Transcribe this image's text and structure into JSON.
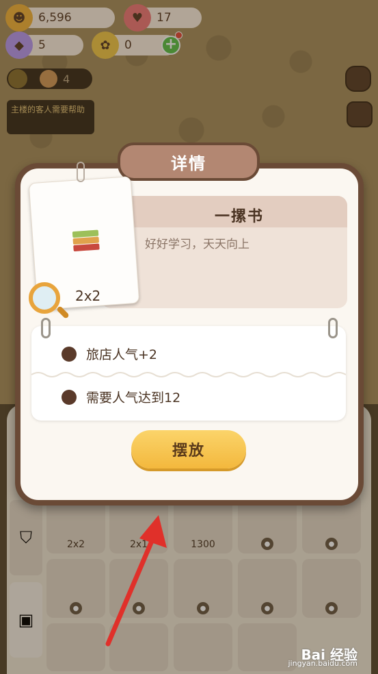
{
  "resources": {
    "coins": "6,596",
    "hearts": "17",
    "gems": "5",
    "tickets": "0"
  },
  "level": {
    "value": "4"
  },
  "quest": {
    "text": "主楼的客人需要帮助"
  },
  "modal": {
    "title": "详情",
    "item_name": "一摞书",
    "item_desc": "好好学习，天天向上",
    "size": "2x2",
    "stats": [
      {
        "label": "旅店人气+2"
      },
      {
        "label": "需要人气达到12"
      }
    ],
    "place_label": "摆放"
  },
  "inventory": {
    "slots_row1": [
      {
        "label": "2x2"
      },
      {
        "label": "2x1"
      },
      {
        "label": "1300"
      },
      {
        "label": ""
      },
      {
        "label": ""
      }
    ]
  },
  "watermark": {
    "brand": "Bai 经验",
    "url": "jingyan.baidu.com"
  },
  "colors": {
    "modal_border": "#6a4a36",
    "button": "#f3b83d",
    "plus": "#5cc24a",
    "arrow": "#e0302a"
  }
}
